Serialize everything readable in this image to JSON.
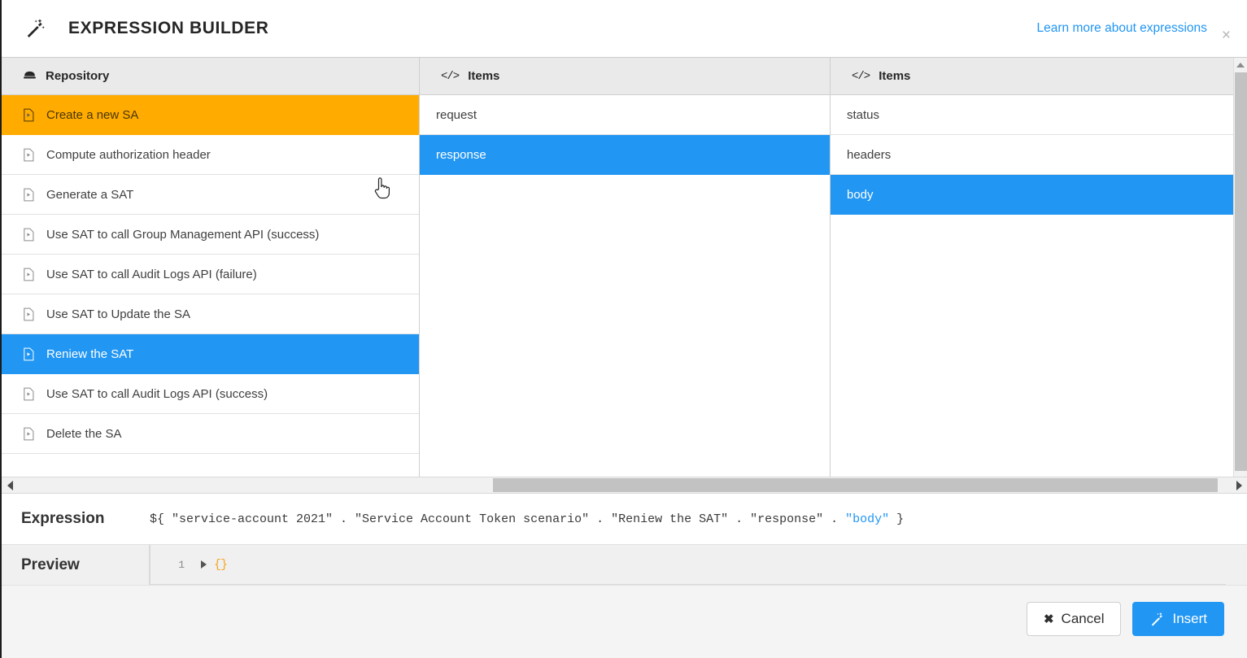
{
  "titlebar": {
    "icon": "magic-wand-icon",
    "title": "EXPRESSION BUILDER",
    "learn_link": "Learn more about expressions",
    "close": "×"
  },
  "colors": {
    "accent_blue": "#2196f3",
    "highlight_orange": "#ffab00",
    "header_gray": "#eaeaea",
    "preview_json_orange": "#f5a623"
  },
  "columns": [
    {
      "id": "repository",
      "icon": "database-icon",
      "header": "Repository",
      "rows": [
        {
          "label": "Create a new SA",
          "icon": "script-file-icon",
          "state": "orange"
        },
        {
          "label": "Compute authorization header",
          "icon": "script-file-icon",
          "state": "none"
        },
        {
          "label": "Generate a SAT",
          "icon": "script-file-icon",
          "state": "none"
        },
        {
          "label": "Use SAT to call Group Management API (success)",
          "icon": "script-file-icon",
          "state": "none"
        },
        {
          "label": "Use SAT to call Audit Logs API (failure)",
          "icon": "script-file-icon",
          "state": "none"
        },
        {
          "label": "Use SAT to Update the SA",
          "icon": "script-file-icon",
          "state": "none"
        },
        {
          "label": "Reniew the SAT",
          "icon": "script-file-icon",
          "state": "blue"
        },
        {
          "label": "Use SAT to call Audit Logs API (success)",
          "icon": "script-file-icon",
          "state": "none"
        },
        {
          "label": "Delete the SA",
          "icon": "script-file-icon",
          "state": "none"
        }
      ]
    },
    {
      "id": "items-1",
      "icon": "code-icon",
      "header": "Items",
      "rows": [
        {
          "label": "request",
          "state": "none"
        },
        {
          "label": "response",
          "state": "blue"
        }
      ]
    },
    {
      "id": "items-2",
      "icon": "code-icon",
      "header": "Items",
      "rows": [
        {
          "label": "status",
          "state": "none"
        },
        {
          "label": "headers",
          "state": "none"
        },
        {
          "label": "body",
          "state": "blue"
        }
      ]
    }
  ],
  "expression": {
    "label": "Expression",
    "prefix": "${ \"service-account 2021\" . \"Service Account Token scenario\" . \"Reniew the SAT\" . \"response\" . ",
    "highlight": "\"body\"",
    "suffix": " }",
    "full": "${ \"service-account 2021\" . \"Service Account Token scenario\" . \"Reniew the SAT\" . \"response\" . \"body\" }"
  },
  "preview": {
    "label": "Preview",
    "line_number": "1",
    "value": "{}"
  },
  "footer": {
    "cancel_label": "Cancel",
    "cancel_icon": "close-x-icon",
    "insert_label": "Insert",
    "insert_icon": "magic-wand-icon"
  }
}
